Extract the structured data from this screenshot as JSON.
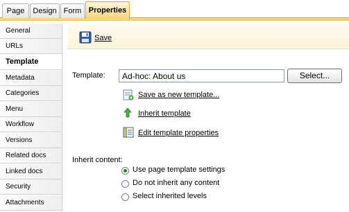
{
  "tabs": [
    {
      "label": "Page",
      "active": false
    },
    {
      "label": "Design",
      "active": false
    },
    {
      "label": "Form",
      "active": false
    },
    {
      "label": "Properties",
      "active": true
    }
  ],
  "sidebar": {
    "items": [
      {
        "label": "General"
      },
      {
        "label": "URLs"
      },
      {
        "label": "Template",
        "active": true
      },
      {
        "label": "Metadata"
      },
      {
        "label": "Categories"
      },
      {
        "label": "Menu"
      },
      {
        "label": "Workflow"
      },
      {
        "label": "Versions"
      },
      {
        "label": "Related docs"
      },
      {
        "label": "Linked docs"
      },
      {
        "label": "Security"
      },
      {
        "label": "Attachments"
      }
    ]
  },
  "toolbar": {
    "save_label": "Save",
    "save_icon": "floppy-disk-icon"
  },
  "template": {
    "label": "Template:",
    "value": "Ad-hoc: About us",
    "select_button": "Select...",
    "actions": [
      {
        "label": "Save as new template...",
        "icon": "save-template-icon"
      },
      {
        "label": "Inherit template",
        "icon": "inherit-arrow-icon"
      },
      {
        "label": "Edit template properties",
        "icon": "edit-properties-icon"
      }
    ]
  },
  "inherit_content": {
    "label": "Inherit content:",
    "options": [
      {
        "label": "Use page template settings",
        "checked": true
      },
      {
        "label": "Do not inherit any content",
        "checked": false
      },
      {
        "label": "Select inherited levels",
        "checked": false
      }
    ]
  },
  "colors": {
    "accent": "#f9d57c",
    "accent_border": "#d7a93b",
    "radio_checked": "#2c7d16"
  }
}
